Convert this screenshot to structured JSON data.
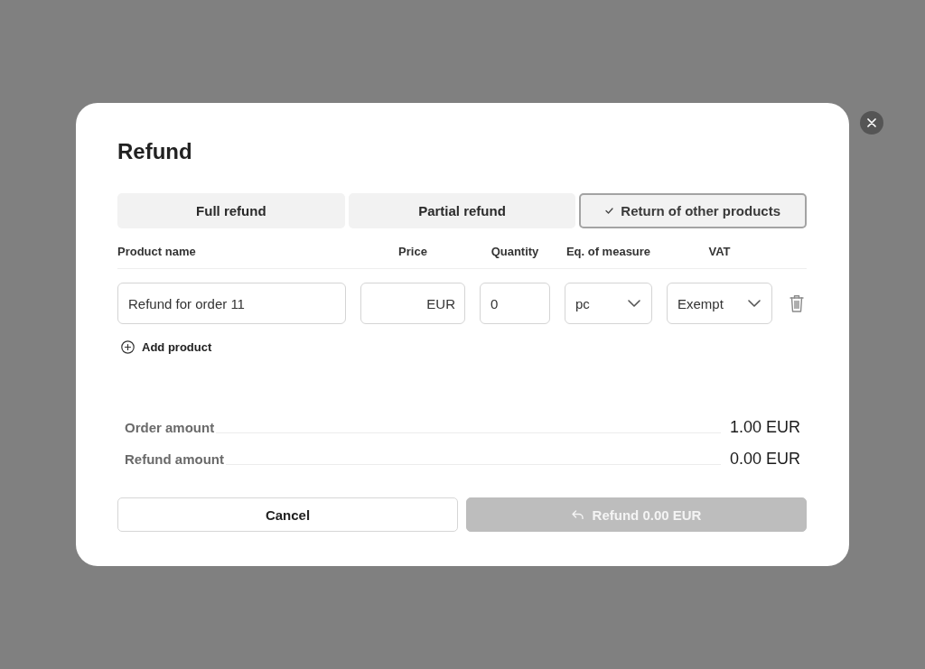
{
  "dialog": {
    "title": "Refund"
  },
  "tabs": [
    {
      "label": "Full refund",
      "selected": false
    },
    {
      "label": "Partial refund",
      "selected": false
    },
    {
      "label": "Return of other products",
      "selected": true
    }
  ],
  "table": {
    "columns": [
      "Product name",
      "Price",
      "Quantity",
      "Eq. of measure",
      "VAT"
    ],
    "rows": [
      {
        "product_name": "Refund for order 11",
        "price": {
          "currency": "EUR"
        },
        "quantity": "0",
        "measure": "pc",
        "vat": "Exempt"
      }
    ]
  },
  "add_product": "Add product",
  "summary": [
    {
      "label": "Order amount",
      "value": "1.00 EUR"
    },
    {
      "label": "Refund amount",
      "value": "0.00 EUR"
    }
  ],
  "buttons": [
    {
      "kind": "secondary",
      "label": "Cancel",
      "disabled": false
    },
    {
      "kind": "primary",
      "label": "Refund 0.00 EUR",
      "disabled": true
    }
  ]
}
